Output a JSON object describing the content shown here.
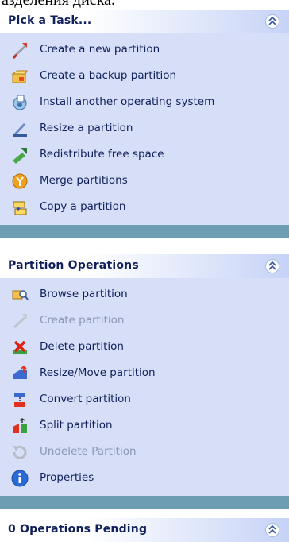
{
  "top_clip_text": "азделения диска.",
  "pick_task": {
    "title": "Pick a Task...",
    "items": [
      {
        "label": "Create a new partition",
        "icon": "create-partition-wand-icon",
        "enabled": true
      },
      {
        "label": "Create a backup partition",
        "icon": "backup-folder-icon",
        "enabled": true
      },
      {
        "label": "Install another operating system",
        "icon": "install-os-icon",
        "enabled": true
      },
      {
        "label": "Resize a partition",
        "icon": "resize-wand-icon",
        "enabled": true
      },
      {
        "label": "Redistribute free space",
        "icon": "redistribute-icon",
        "enabled": true
      },
      {
        "label": "Merge partitions",
        "icon": "merge-icon",
        "enabled": true
      },
      {
        "label": "Copy a partition",
        "icon": "copy-partition-icon",
        "enabled": true
      }
    ]
  },
  "partition_ops": {
    "title": "Partition Operations",
    "items": [
      {
        "label": "Browse partition",
        "icon": "browse-icon",
        "enabled": true
      },
      {
        "label": "Create partition",
        "icon": "create-partition-icon",
        "enabled": false
      },
      {
        "label": "Delete partition",
        "icon": "delete-partition-icon",
        "enabled": true
      },
      {
        "label": "Resize/Move partition",
        "icon": "resize-move-icon",
        "enabled": true
      },
      {
        "label": "Convert partition",
        "icon": "convert-partition-icon",
        "enabled": true
      },
      {
        "label": "Split partition",
        "icon": "split-partition-icon",
        "enabled": true
      },
      {
        "label": "Undelete Partition",
        "icon": "undelete-icon",
        "enabled": false
      },
      {
        "label": "Properties",
        "icon": "info-icon",
        "enabled": true
      }
    ]
  },
  "pending": {
    "title": "0 Operations Pending"
  },
  "colors": {
    "header_text": "#10205c",
    "panel_body": "#d6dff7",
    "separator": "#6c9db2",
    "disabled_text": "#8d96b3"
  }
}
